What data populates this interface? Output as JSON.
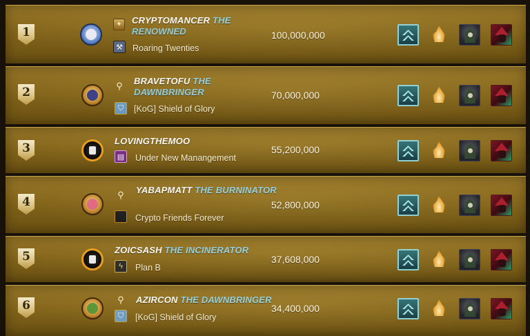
{
  "leaderboard": {
    "rows": [
      {
        "rank": "1",
        "player": "CRYPTOMANCER",
        "title": "THE RENOWNED",
        "guild": "Roaring Twenties",
        "score": "100,000,000",
        "avatar_icon": "wizard-avatar-icon",
        "title_icon": "renowned-badge-icon",
        "guild_icon": "axe-banner-icon"
      },
      {
        "rank": "2",
        "player": "BRAVETOFU",
        "title": "THE DAWNBRINGER",
        "guild": "[KoG] Shield of Glory",
        "score": "70,000,000",
        "avatar_icon": "hooded-avatar-icon",
        "title_icon": "dawnbringer-icon",
        "guild_icon": "shield-icon"
      },
      {
        "rank": "3",
        "player": "LOVINGTHEMOO",
        "title": "",
        "guild": "Under New Manangement",
        "score": "55,200,000",
        "avatar_icon": "monster-avatar-icon",
        "title_icon": "",
        "guild_icon": "book-icon"
      },
      {
        "rank": "4",
        "player": "YABAPMATT",
        "title": "THE BURNINATOR",
        "guild": "Crypto Friends Forever",
        "score": "52,800,000",
        "avatar_icon": "pink-avatar-icon",
        "title_icon": "burninator-icon",
        "guild_icon": "dark-banner-icon"
      },
      {
        "rank": "5",
        "player": "ZOICSASH",
        "title": "THE INCINERATOR",
        "guild": "Plan B",
        "score": "37,608,000",
        "avatar_icon": "monster-avatar-icon",
        "title_icon": "",
        "guild_icon": "lightning-banner-icon"
      },
      {
        "rank": "6",
        "player": "AZIRCON",
        "title": "THE DAWNBRINGER",
        "guild": "[KoG] Shield of Glory",
        "score": "34,400,000",
        "avatar_icon": "green-avatar-icon",
        "title_icon": "dawnbringer-icon",
        "guild_icon": "shield-icon"
      }
    ],
    "cards": [
      "league-chevron-card-icon",
      "fire-splinter-card-icon",
      "hooded-skull-card-icon",
      "red-hat-card-icon"
    ]
  },
  "colors": {
    "row_gold": "#8a6a1c",
    "title_blue": "#8fd2e8",
    "name_white": "#ffffff"
  }
}
